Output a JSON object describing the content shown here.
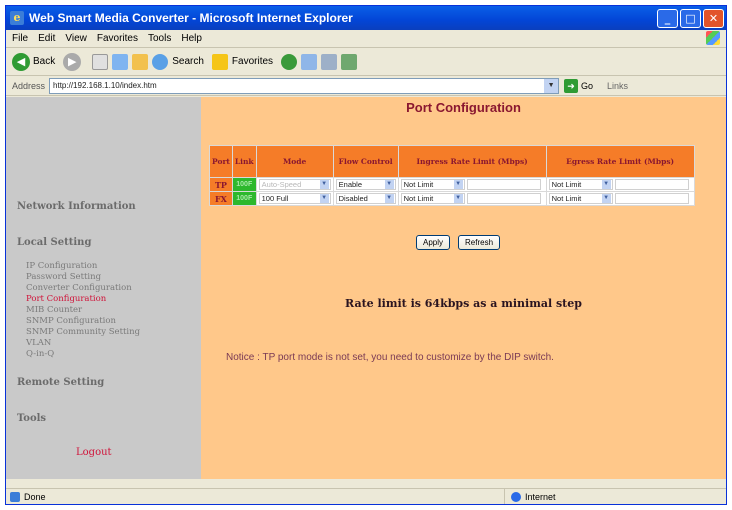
{
  "window": {
    "title": "Web Smart Media Converter - Microsoft Internet Explorer",
    "controls": {
      "minimize": "_",
      "maximize": "□",
      "close": "✕"
    }
  },
  "menu": [
    "File",
    "Edit",
    "View",
    "Favorites",
    "Tools",
    "Help"
  ],
  "toolbar": {
    "back": "Back",
    "search": "Search",
    "favorites": "Favorites"
  },
  "address": {
    "label": "Address",
    "url": "http://192.168.1.10/index.htm",
    "go": "Go",
    "links": "Links"
  },
  "sidebar": {
    "network_information": "Network Information",
    "local_setting": "Local Setting",
    "items": [
      {
        "label": "IP Configuration",
        "active": false
      },
      {
        "label": "Password Setting",
        "active": false
      },
      {
        "label": "Converter Configuration",
        "active": false
      },
      {
        "label": "Port Configuration",
        "active": true
      },
      {
        "label": "MIB Counter",
        "active": false
      },
      {
        "label": "SNMP Configuration",
        "active": false
      },
      {
        "label": "SNMP Community Setting",
        "active": false
      },
      {
        "label": "VLAN",
        "active": false
      },
      {
        "label": "Q-in-Q",
        "active": false
      }
    ],
    "remote_setting": "Remote Setting",
    "tools": "Tools",
    "logout": "Logout"
  },
  "main": {
    "title": "Port Configuration",
    "table": {
      "headers": [
        "Port",
        "Link",
        "Mode",
        "Flow Control",
        "Ingress Rate Limit (Mbps)",
        "Egress Rate Limit (Mbps)"
      ],
      "rows": [
        {
          "port": "TP",
          "link": "100F",
          "mode": "Auto-Speed",
          "mode_disabled": true,
          "flow": "Enable",
          "ingress": "Not Limit",
          "ingress_value": "",
          "egress": "Not Limit",
          "egress_value": ""
        },
        {
          "port": "FX",
          "link": "100F",
          "mode": "100 Full",
          "mode_disabled": false,
          "flow": "Disabled",
          "ingress": "Not Limit",
          "ingress_value": "",
          "egress": "Not Limit",
          "egress_value": ""
        }
      ]
    },
    "apply": "Apply",
    "refresh": "Refresh",
    "rate_note": "Rate limit is 64kbps as a minimal step",
    "notice": "Notice : TP port mode is not set, you need to customize by the DIP switch."
  },
  "status": {
    "left": "Done",
    "zone": "Internet"
  },
  "colors": {
    "sidebar_bg": "#c9c9c9",
    "main_bg": "#ffc88a",
    "table_header": "#f57c28",
    "link_up": "#2db82d",
    "accent_red": "#d0143a"
  }
}
